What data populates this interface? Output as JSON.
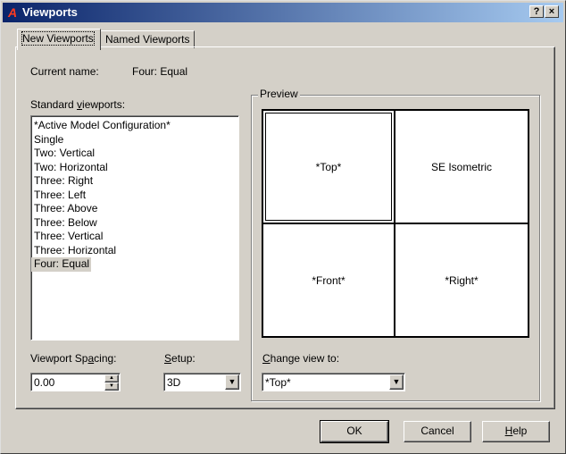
{
  "window": {
    "title": "Viewports",
    "help_button": "?",
    "close_button": "×"
  },
  "tabs": [
    {
      "label": "New Viewports",
      "active": true
    },
    {
      "label": "Named Viewports",
      "active": false
    }
  ],
  "current_name": {
    "label": "Current name:",
    "value": "Four:  Equal"
  },
  "standard_viewports": {
    "label_pre": "Standard ",
    "label_accel": "v",
    "label_post": "iewports:",
    "items": [
      "*Active Model Configuration*",
      "Single",
      "Two:  Vertical",
      "Two:  Horizontal",
      "Three: Right",
      "Three: Left",
      "Three: Above",
      "Three: Below",
      "Three: Vertical",
      "Three: Horizontal",
      "Four:  Equal"
    ],
    "selected_index": 10
  },
  "preview": {
    "caption": "Preview",
    "viewports": [
      {
        "label": "*Top*",
        "active": true
      },
      {
        "label": "SE Isometric",
        "active": false
      },
      {
        "label": "*Front*",
        "active": false
      },
      {
        "label": "*Right*",
        "active": false
      }
    ]
  },
  "viewport_spacing": {
    "label_pre": "Viewport Sp",
    "label_accel": "a",
    "label_post": "cing:",
    "value": "0.00"
  },
  "setup": {
    "label_accel": "S",
    "label_post": "etup:",
    "value": "3D"
  },
  "change_view_to": {
    "label_accel": "C",
    "label_post": "hange view to:",
    "value": "*Top*"
  },
  "buttons": {
    "ok": "OK",
    "cancel": "Cancel",
    "help_accel": "H",
    "help_post": "elp"
  },
  "colors": {
    "titlebar_start": "#0a246a",
    "titlebar_end": "#a6caf0",
    "face": "#d4d0c8",
    "app_icon": "#ff3b1f"
  }
}
